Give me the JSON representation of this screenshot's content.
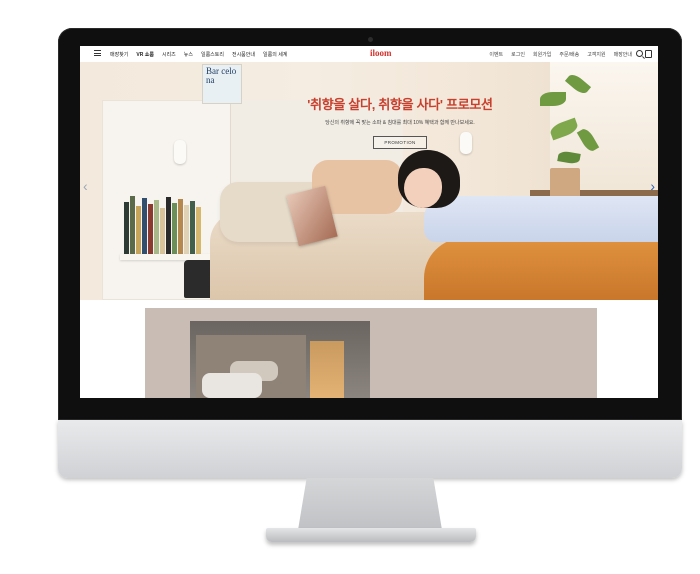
{
  "header": {
    "logo": "iloom",
    "nav_left": [
      "매장찾기",
      "VR 쇼룸",
      "시리즈",
      "뉴스",
      "일룸스토리",
      "전시품안내",
      "일룸의 세계"
    ],
    "nav_right": [
      "이벤트",
      "로그인",
      "회원가입",
      "주문/배송",
      "고객지원",
      "매장안내"
    ]
  },
  "hero": {
    "title": "'취향을 살다, 취향을 사다' 프로모션",
    "subtitle": "당신의 취향에 꼭 맞는 소파 & 침대를 최대 10% 혜택과 함께 만나보세요.",
    "button_label": "PROMOTION",
    "poster_text": "Bar celo na"
  },
  "colors": {
    "brand": "#d2322d",
    "headline": "#c8402d",
    "carousel_arrow_active": "#2e62b0"
  },
  "icons": {
    "menu": "hamburger-icon",
    "search": "search-icon",
    "cart": "shopping-bag-icon",
    "prev": "chevron-left-icon",
    "next": "chevron-right-icon"
  }
}
